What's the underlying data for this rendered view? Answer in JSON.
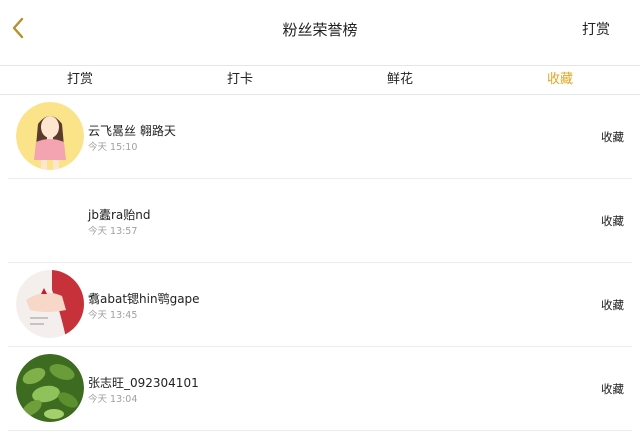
{
  "header": {
    "title": "粉丝荣誉榜",
    "right_action": "打赏",
    "accent_color": "#e3a623"
  },
  "tabs": [
    {
      "label": "打赏",
      "active": false
    },
    {
      "label": "打卡",
      "active": false
    },
    {
      "label": "鲜花",
      "active": false
    },
    {
      "label": "收藏",
      "active": true
    }
  ],
  "rows": [
    {
      "name": "云飞暠丝 翱路天",
      "time": "今天 15:10",
      "action": "收藏",
      "avatar": "cartoon-girl"
    },
    {
      "name": "jb蠹ra贻nd",
      "time": "今天 13:57",
      "action": "收藏",
      "avatar": "blank"
    },
    {
      "name": "翥abat锶hin鹗gape",
      "time": "今天 13:45",
      "action": "收藏",
      "avatar": "hand-photo"
    },
    {
      "name": "张志旺_092304101",
      "time": "今天 13:04",
      "action": "收藏",
      "avatar": "green-leaves"
    }
  ]
}
